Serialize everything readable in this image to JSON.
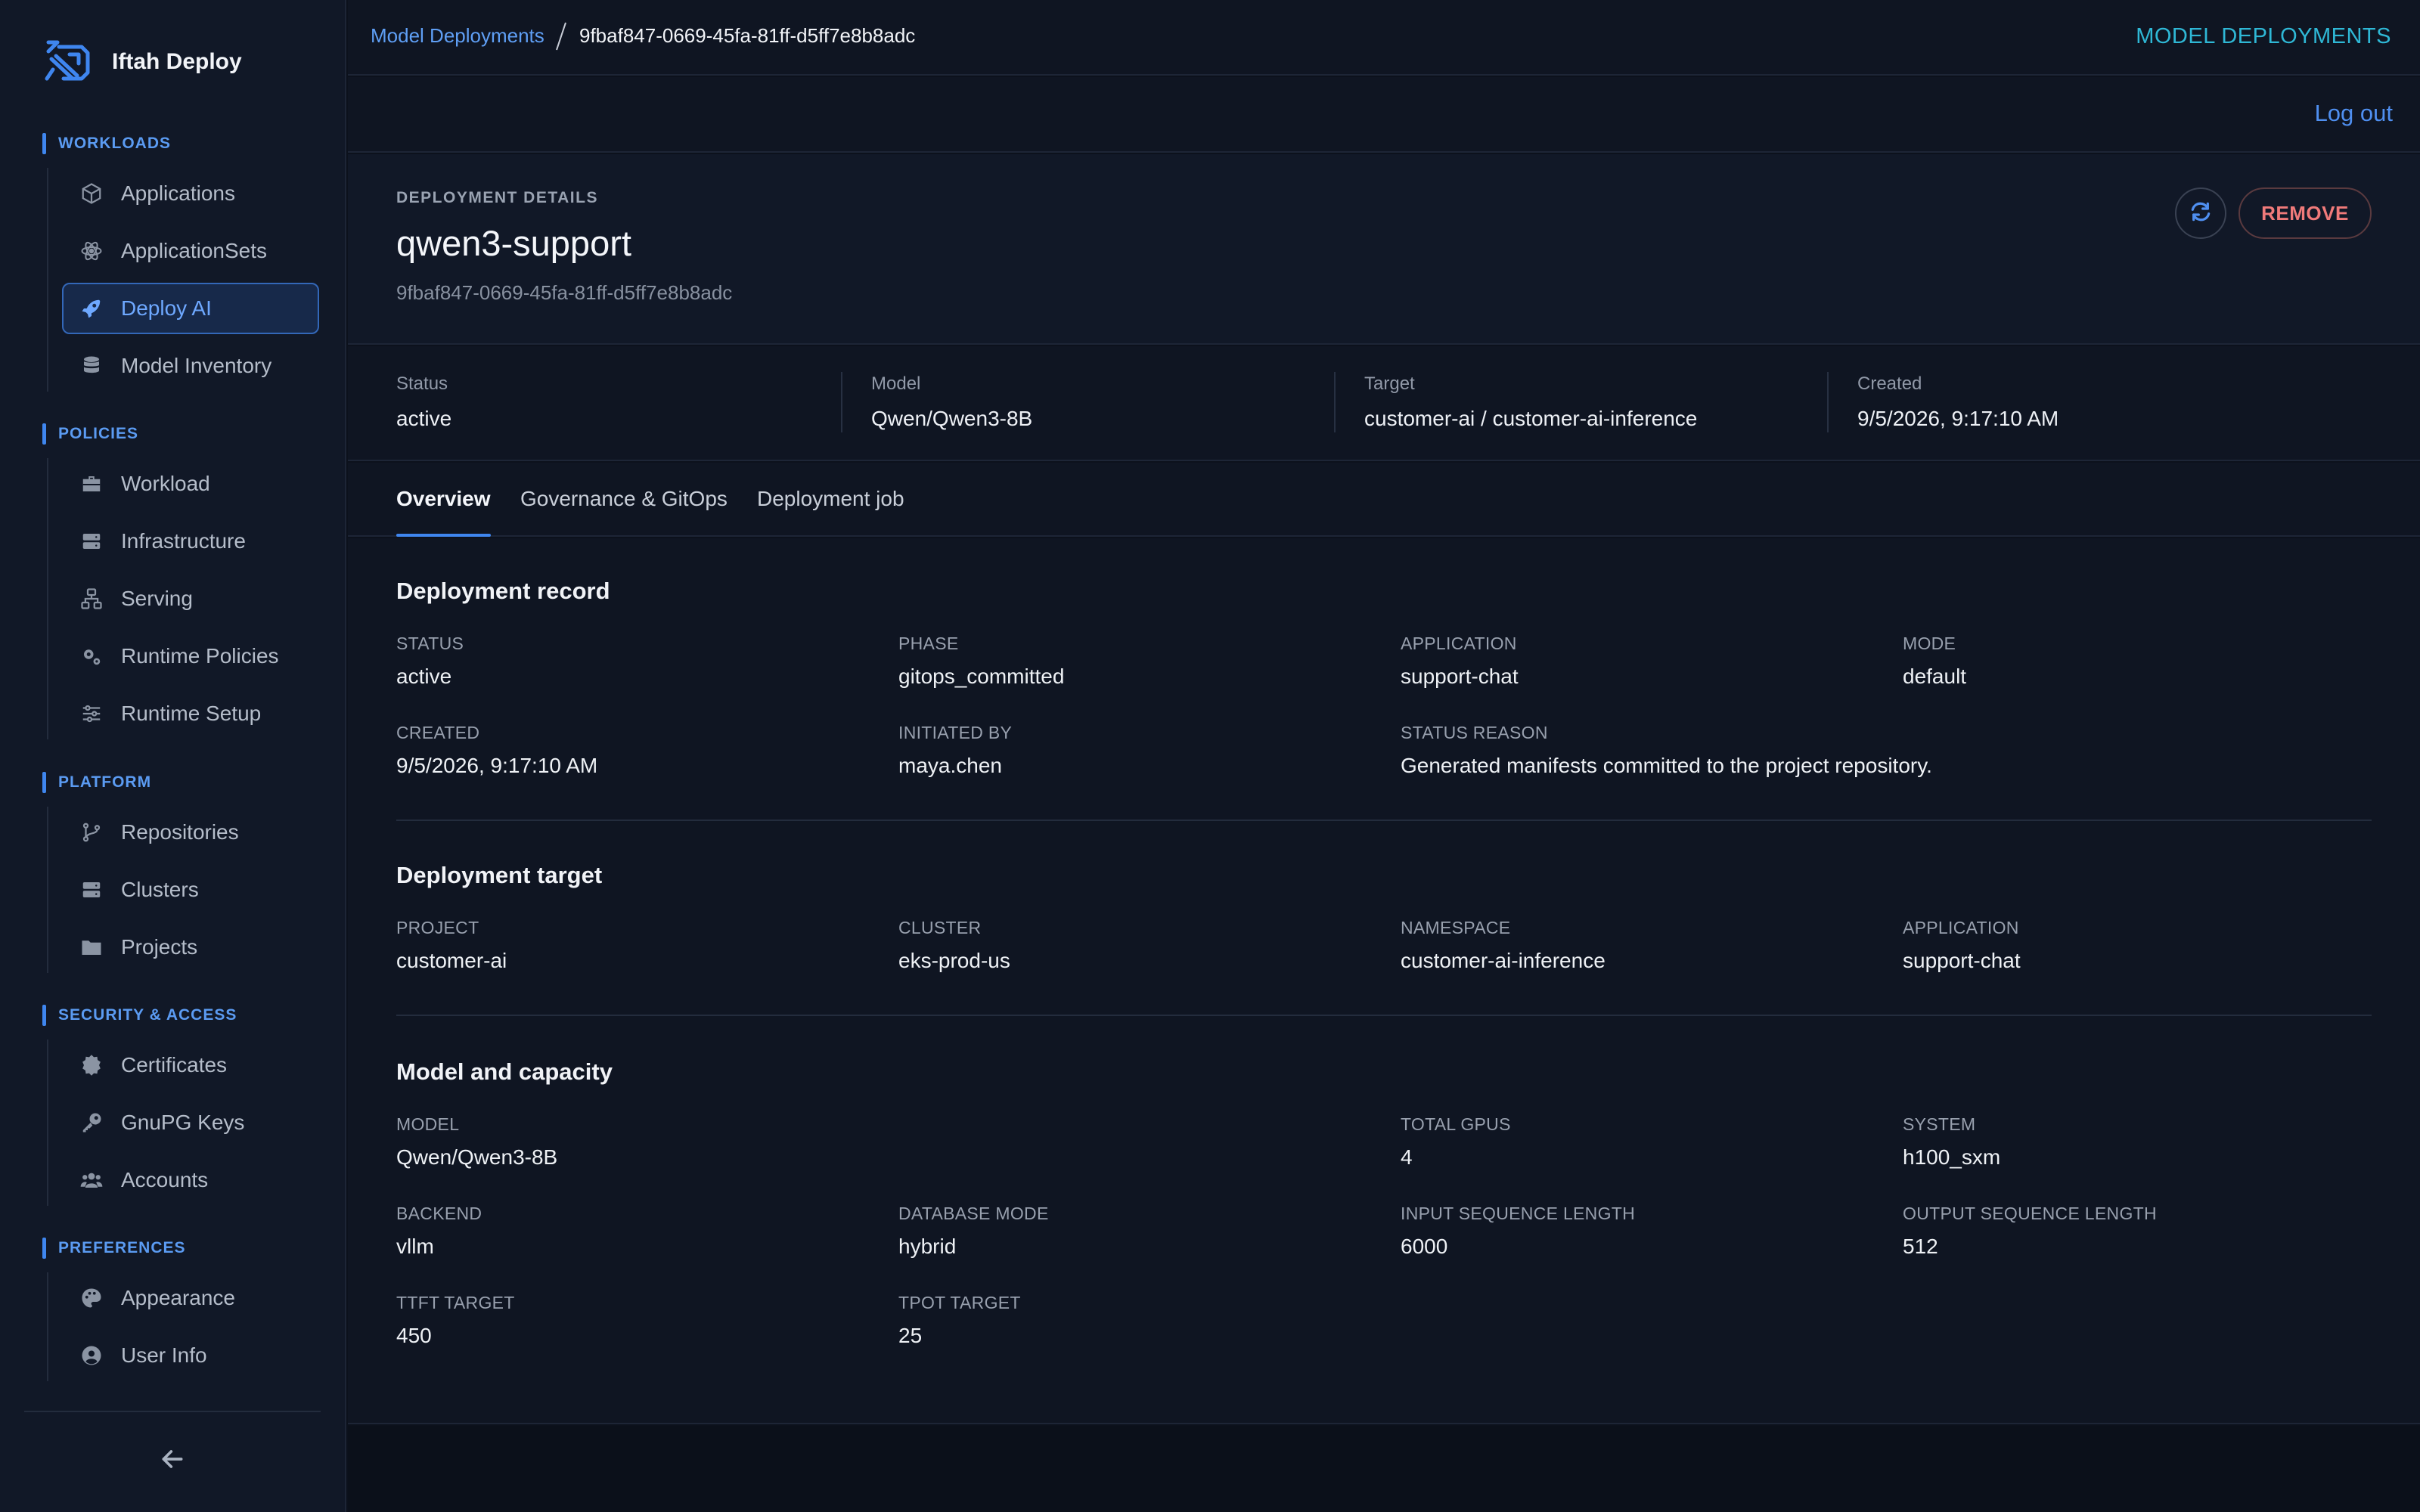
{
  "brand": {
    "name": "Iftah Deploy"
  },
  "sidebar": {
    "groups": [
      {
        "label": "WORKLOADS",
        "items": [
          {
            "label": "Applications",
            "icon": "cube-icon"
          },
          {
            "label": "ApplicationSets",
            "icon": "atom-icon"
          },
          {
            "label": "Deploy AI",
            "icon": "rocket-icon",
            "active": true
          },
          {
            "label": "Model Inventory",
            "icon": "database-icon"
          }
        ]
      },
      {
        "label": "POLICIES",
        "items": [
          {
            "label": "Workload",
            "icon": "briefcase-icon"
          },
          {
            "label": "Infrastructure",
            "icon": "server-icon"
          },
          {
            "label": "Serving",
            "icon": "network-icon"
          },
          {
            "label": "Runtime Policies",
            "icon": "gears-icon"
          },
          {
            "label": "Runtime Setup",
            "icon": "sliders-icon"
          }
        ]
      },
      {
        "label": "PLATFORM",
        "items": [
          {
            "label": "Repositories",
            "icon": "git-branch-icon"
          },
          {
            "label": "Clusters",
            "icon": "server-icon"
          },
          {
            "label": "Projects",
            "icon": "folder-icon"
          }
        ]
      },
      {
        "label": "SECURITY & ACCESS",
        "items": [
          {
            "label": "Certificates",
            "icon": "certificate-icon"
          },
          {
            "label": "GnuPG Keys",
            "icon": "key-icon"
          },
          {
            "label": "Accounts",
            "icon": "users-icon"
          }
        ]
      },
      {
        "label": "PREFERENCES",
        "items": [
          {
            "label": "Appearance",
            "icon": "palette-icon"
          },
          {
            "label": "User Info",
            "icon": "user-circle-icon"
          }
        ]
      }
    ]
  },
  "topbar": {
    "breadcrumb_link": "Model Deployments",
    "breadcrumb_current": "9fbaf847-0669-45fa-81ff-d5ff7e8b8adc",
    "right_link": "MODEL DEPLOYMENTS",
    "logout": "Log out"
  },
  "header": {
    "eyebrow": "DEPLOYMENT DETAILS",
    "title": "qwen3-support",
    "id": "9fbaf847-0669-45fa-81ff-d5ff7e8b8adc",
    "remove_label": "REMOVE"
  },
  "summary": [
    {
      "label": "Status",
      "value": "active"
    },
    {
      "label": "Model",
      "value": "Qwen/Qwen3-8B"
    },
    {
      "label": "Target",
      "value": "customer-ai / customer-ai-inference"
    },
    {
      "label": "Created",
      "value": "9/5/2026, 9:17:10 AM"
    }
  ],
  "tabs": [
    {
      "label": "Overview",
      "active": true
    },
    {
      "label": "Governance & GitOps"
    },
    {
      "label": "Deployment job"
    }
  ],
  "sections": {
    "record": {
      "title": "Deployment record",
      "fields": [
        {
          "label": "STATUS",
          "value": "active"
        },
        {
          "label": "PHASE",
          "value": "gitops_committed"
        },
        {
          "label": "APPLICATION",
          "value": "support-chat"
        },
        {
          "label": "MODE",
          "value": "default"
        },
        {
          "label": "CREATED",
          "value": "9/5/2026, 9:17:10 AM"
        },
        {
          "label": "INITIATED BY",
          "value": "maya.chen"
        },
        {
          "label": "STATUS REASON",
          "value": "Generated manifests committed to the project repository."
        }
      ]
    },
    "target": {
      "title": "Deployment target",
      "fields": [
        {
          "label": "PROJECT",
          "value": "customer-ai"
        },
        {
          "label": "CLUSTER",
          "value": "eks-prod-us"
        },
        {
          "label": "NAMESPACE",
          "value": "customer-ai-inference"
        },
        {
          "label": "APPLICATION",
          "value": "support-chat"
        }
      ]
    },
    "capacity": {
      "title": "Model and capacity",
      "fields": [
        {
          "label": "MODEL",
          "value": "Qwen/Qwen3-8B"
        },
        {
          "label": "TOTAL GPUS",
          "value": "4"
        },
        {
          "label": "SYSTEM",
          "value": "h100_sxm"
        },
        {
          "label": "BACKEND",
          "value": "vllm"
        },
        {
          "label": "DATABASE MODE",
          "value": "hybrid"
        },
        {
          "label": "INPUT SEQUENCE LENGTH",
          "value": "6000"
        },
        {
          "label": "OUTPUT SEQUENCE LENGTH",
          "value": "512"
        },
        {
          "label": "TTFT TARGET",
          "value": "450"
        },
        {
          "label": "TPOT TARGET",
          "value": "25"
        }
      ]
    }
  },
  "colors": {
    "accent": "#3f86ef",
    "cyan_link": "#2fb8d6",
    "danger": "#f07a7a",
    "background": "#0f1522",
    "sidebar": "#111827"
  }
}
